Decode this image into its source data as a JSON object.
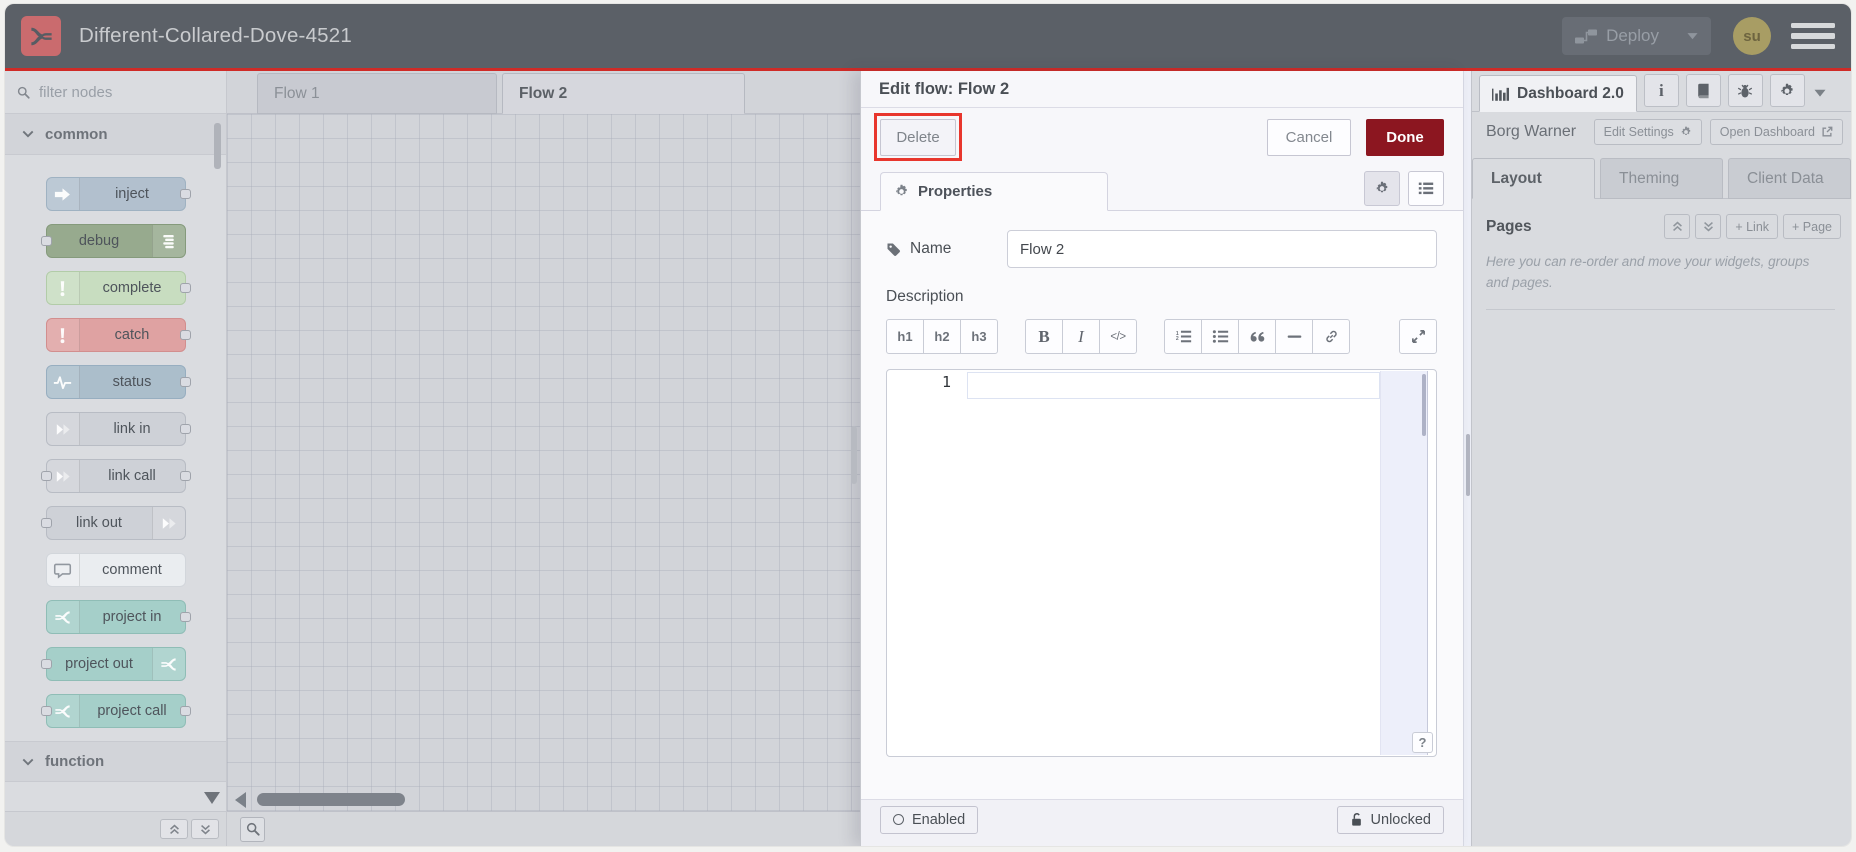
{
  "colors": {
    "header_bg": "#5b6067",
    "accent_red_line": "#cf2b27",
    "logo_red": "#ca6b6e",
    "avatar_bg": "#a89d64",
    "done_button": "#8c1620",
    "annotation_highlight": "#e8362d"
  },
  "header": {
    "title": "Different-Collared-Dove-4521",
    "deploy_label": "Deploy",
    "avatar_initials": "su"
  },
  "palette": {
    "filter_placeholder": "filter nodes",
    "categories": [
      {
        "label": "common"
      },
      {
        "label": "function"
      }
    ],
    "nodes": [
      {
        "label": "inject",
        "fill": "#b2c0ce",
        "border": "#9fb2c2",
        "icon": "inject",
        "icon_side": "left",
        "port_left": false,
        "port_right": true
      },
      {
        "label": "debug",
        "fill": "#97aa8e",
        "border": "#859a7c",
        "icon": "debug",
        "icon_side": "right",
        "port_left": true,
        "port_right": false
      },
      {
        "label": "complete",
        "fill": "#c8ddc0",
        "border": "#b2cca8",
        "icon": "exclaim",
        "icon_side": "left",
        "port_left": false,
        "port_right": true
      },
      {
        "label": "catch",
        "fill": "#dfa2a2",
        "border": "#d28e8e",
        "icon": "exclaim",
        "icon_side": "left",
        "port_left": false,
        "port_right": true
      },
      {
        "label": "status",
        "fill": "#abbecb",
        "border": "#97aec0",
        "icon": "pulse",
        "icon_side": "left",
        "port_left": false,
        "port_right": true
      },
      {
        "label": "link in",
        "fill": "#ced1d7",
        "border": "#b8bcc4",
        "icon": "linkarrow",
        "icon_side": "left",
        "port_left": false,
        "port_right": true
      },
      {
        "label": "link call",
        "fill": "#ced1d7",
        "border": "#b8bcc4",
        "icon": "linkarrow",
        "icon_side": "left",
        "port_left": true,
        "port_right": true
      },
      {
        "label": "link out",
        "fill": "#ced1d7",
        "border": "#b8bcc4",
        "icon": "linkarrow",
        "icon_side": "right",
        "port_left": true,
        "port_right": false
      },
      {
        "label": "comment",
        "fill": "#eaedf0",
        "border": "#d2d6db",
        "icon": "comment",
        "icon_side": "left",
        "port_left": false,
        "port_right": false,
        "icon_color": "#8d939b"
      },
      {
        "label": "project in",
        "fill": "#a5cfc9",
        "border": "#8fbdb6",
        "icon": "fork",
        "icon_side": "left",
        "port_left": false,
        "port_right": true
      },
      {
        "label": "project out",
        "fill": "#a5cfc9",
        "border": "#8fbdb6",
        "icon": "fork",
        "icon_side": "right",
        "port_left": true,
        "port_right": false
      },
      {
        "label": "project call",
        "fill": "#a5cfc9",
        "border": "#8fbdb6",
        "icon": "fork",
        "icon_side": "left",
        "port_left": true,
        "port_right": true
      }
    ]
  },
  "workspace": {
    "tabs": [
      {
        "label": "Flow 1",
        "active": false
      },
      {
        "label": "Flow 2",
        "active": true
      }
    ]
  },
  "tray": {
    "title": "Edit flow: Flow 2",
    "delete_label": "Delete",
    "cancel_label": "Cancel",
    "done_label": "Done",
    "properties_tab_label": "Properties",
    "name_label": "Name",
    "name_value": "Flow 2",
    "description_label": "Description",
    "editor_toolbar": {
      "groups": [
        [
          {
            "kind": "text",
            "label": "h1",
            "style": "h",
            "name": "heading1-button"
          },
          {
            "kind": "text",
            "label": "h2",
            "style": "h",
            "name": "heading2-button"
          },
          {
            "kind": "text",
            "label": "h3",
            "style": "h",
            "name": "heading3-button"
          }
        ],
        [
          {
            "kind": "text",
            "label": "B",
            "style": "bold",
            "name": "bold-button"
          },
          {
            "kind": "text",
            "label": "I",
            "style": "italic",
            "name": "italic-button"
          },
          {
            "kind": "text",
            "label": "</>",
            "style": "code",
            "name": "code-button"
          }
        ],
        [
          {
            "kind": "icon",
            "icon": "ol",
            "name": "ordered-list-button"
          },
          {
            "kind": "icon",
            "icon": "ul",
            "name": "unordered-list-button"
          },
          {
            "kind": "icon",
            "icon": "quote",
            "name": "blockquote-button"
          },
          {
            "kind": "icon",
            "icon": "hr",
            "name": "horizontal-rule-button"
          },
          {
            "kind": "icon",
            "icon": "chain",
            "name": "insert-link-button"
          }
        ]
      ],
      "expand_icon": "expand"
    },
    "editor_line_number": "1",
    "editor_help_label": "?",
    "enabled_label": "Enabled",
    "unlocked_label": "Unlocked"
  },
  "sidebar": {
    "tab_label": "Dashboard 2.0",
    "header_icons": [
      "info",
      "book",
      "bug",
      "gear"
    ],
    "instance_name": "Borg Warner",
    "edit_settings_label": "Edit Settings",
    "open_dashboard_label": "Open Dashboard",
    "subtabs": [
      "Layout",
      "Theming",
      "Client Data"
    ],
    "pages_label": "Pages",
    "add_link_label": "+ Link",
    "add_page_label": "+ Page",
    "help_text": "Here you can re-order and move your widgets, groups and pages."
  }
}
